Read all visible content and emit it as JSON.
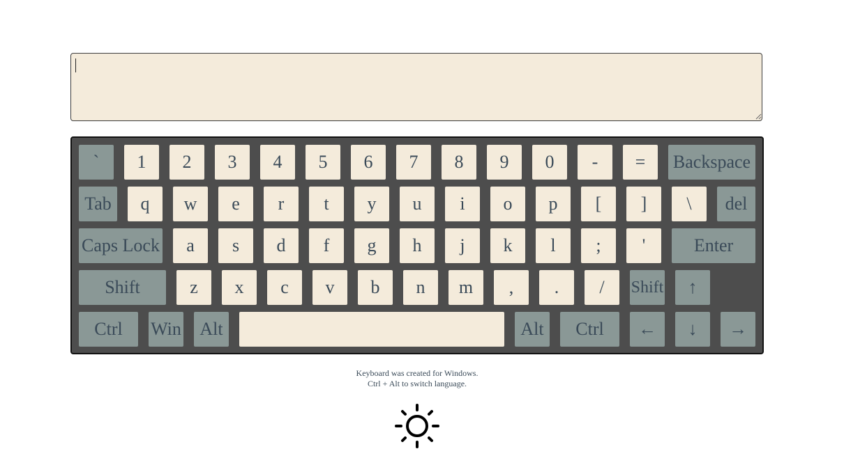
{
  "input": {
    "value": "",
    "placeholder": ""
  },
  "keyboard": {
    "rows": [
      [
        "`",
        "1",
        "2",
        "3",
        "4",
        "5",
        "6",
        "7",
        "8",
        "9",
        "0",
        "-",
        "=",
        "Backspace"
      ],
      [
        "Tab",
        "q",
        "w",
        "e",
        "r",
        "t",
        "y",
        "u",
        "i",
        "o",
        "p",
        "[",
        "]",
        "\\",
        "del"
      ],
      [
        "Caps Lock",
        "a",
        "s",
        "d",
        "f",
        "g",
        "h",
        "j",
        "k",
        "l",
        ";",
        "'",
        "Enter"
      ],
      [
        "Shift",
        "z",
        "x",
        "c",
        "v",
        "b",
        "n",
        "m",
        ",",
        ".",
        "/",
        "Shift",
        "↑"
      ],
      [
        "Ctrl",
        "Win",
        "Alt",
        "",
        "Alt",
        "Ctrl",
        "←",
        "↓",
        "→"
      ]
    ]
  },
  "footer": {
    "line1": "Keyboard was created for Windows.",
    "line2": "Ctrl + Alt to switch language."
  },
  "icons": {
    "theme_toggle": "sun-icon"
  },
  "colors": {
    "key_light": "#f4ebdb",
    "key_dark": "#8a9896",
    "keyboard_bg": "#4d4d4d",
    "text": "#3a4a58"
  }
}
